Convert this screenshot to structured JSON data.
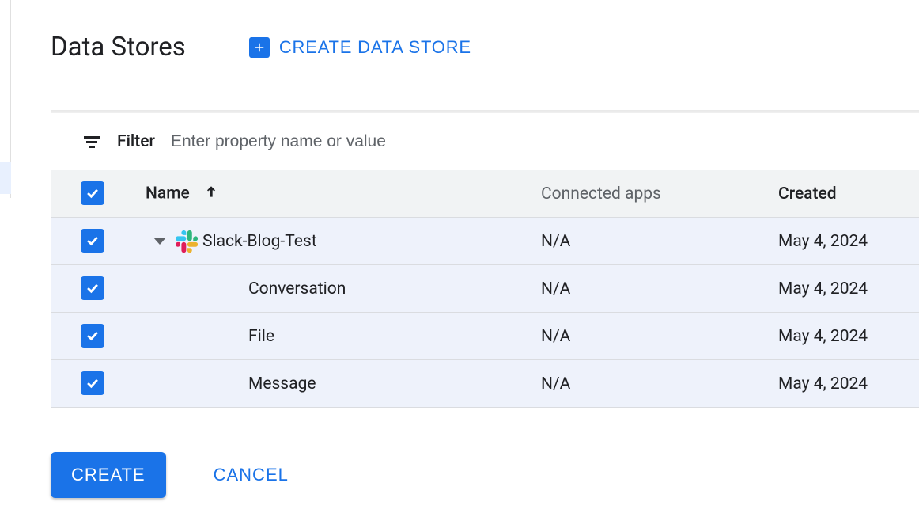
{
  "header": {
    "title": "Data Stores",
    "create_button_label": "CREATE DATA STORE"
  },
  "filter": {
    "label": "Filter",
    "placeholder": "Enter property name or value"
  },
  "table": {
    "columns": {
      "name": "Name",
      "connected_apps": "Connected apps",
      "created": "Created"
    },
    "sort_column": "name",
    "sort_direction": "asc",
    "rows": [
      {
        "checked": true,
        "name": "Slack-Blog-Test",
        "connected_apps": "N/A",
        "created": "May 4, 2024",
        "indent": 0,
        "has_icon": true,
        "expandable": true
      },
      {
        "checked": true,
        "name": "Conversation",
        "connected_apps": "N/A",
        "created": "May 4, 2024",
        "indent": 1,
        "has_icon": false,
        "expandable": false
      },
      {
        "checked": true,
        "name": "File",
        "connected_apps": "N/A",
        "created": "May 4, 2024",
        "indent": 1,
        "has_icon": false,
        "expandable": false
      },
      {
        "checked": true,
        "name": "Message",
        "connected_apps": "N/A",
        "created": "May 4, 2024",
        "indent": 1,
        "has_icon": false,
        "expandable": false
      }
    ]
  },
  "footer": {
    "create_label": "CREATE",
    "cancel_label": "CANCEL"
  }
}
